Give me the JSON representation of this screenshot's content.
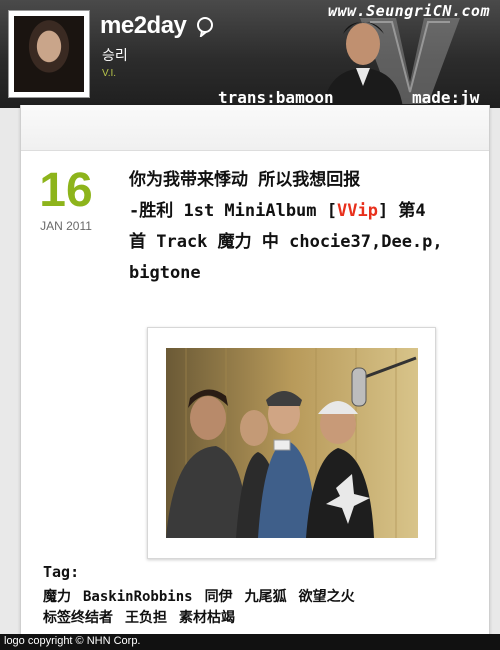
{
  "header": {
    "brand": "me2day",
    "user_name": "승리",
    "user_tag": "V.I.",
    "watermark": "www.SeungriCN.com",
    "trans_credit": "trans:bamoon",
    "made_credit": "made:jw"
  },
  "post": {
    "date_day": "16",
    "date_month": "JAN 2011",
    "line1": "你为我带来悸动 所以我想回报",
    "line2_pre": "-胜利 1st MiniAlbum [",
    "line2_accent": "VVip",
    "line2_post": "] 第4",
    "line3": "首 Track 魔力 中 chocie37,Dee.p,",
    "line4": "bigtone"
  },
  "tags": {
    "title": "Tag:",
    "items": [
      "魔力",
      "BaskinRobbins",
      "同伊",
      "九尾狐",
      "欲望之火",
      "标签终结者",
      "王负担",
      "素材枯竭"
    ]
  },
  "footer": {
    "text": "logo copyright © NHN Corp."
  },
  "colors": {
    "date_green": "#8db41b",
    "accent_red": "#e8301c",
    "header_dark": "#2c2c2c"
  }
}
